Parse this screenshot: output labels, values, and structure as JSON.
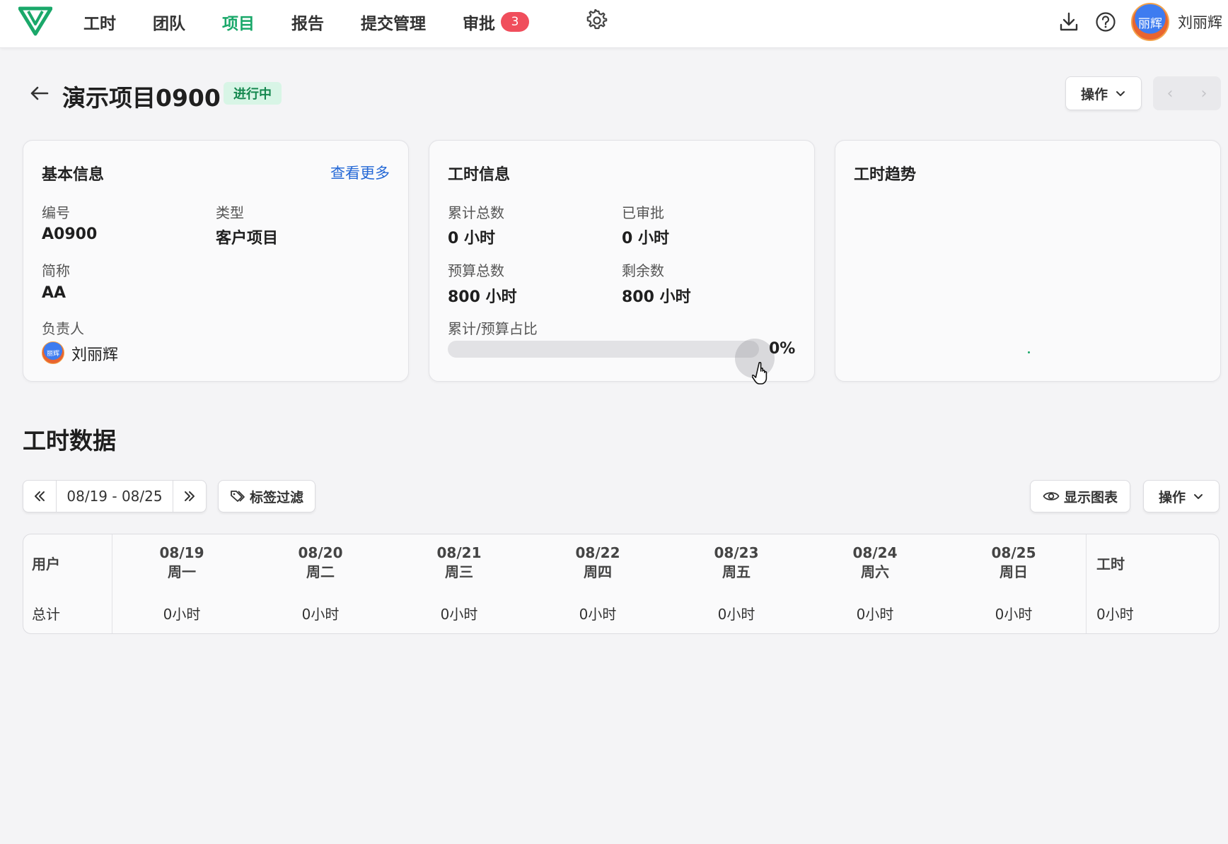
{
  "nav": {
    "items": [
      {
        "label": "工时",
        "active": false
      },
      {
        "label": "团队",
        "active": false
      },
      {
        "label": "项目",
        "active": true
      },
      {
        "label": "报告",
        "active": false
      },
      {
        "label": "提交管理",
        "active": false
      },
      {
        "label": "审批",
        "active": false,
        "badge": "3"
      }
    ],
    "settings_icon": "gear-icon",
    "download_icon": "download-icon",
    "help_icon": "help-circle-icon",
    "avatar_text": "丽辉",
    "user_name": "刘丽辉",
    "accent_color": "#1aa86a",
    "badge_color": "#f04e5c"
  },
  "page": {
    "back_icon": "arrow-left-icon",
    "title": "演示项目0900",
    "status": "进行中",
    "ops_label": "操作"
  },
  "basic_info": {
    "title": "基本信息",
    "more_link": "查看更多",
    "code_label": "编号",
    "code_value": "A0900",
    "type_label": "类型",
    "type_value": "客户项目",
    "short_label": "简称",
    "short_value": "AA",
    "owner_label": "负责人",
    "owner_avatar": "丽辉",
    "owner_name": "刘丽辉"
  },
  "hours_info": {
    "title": "工时信息",
    "total_label": "累计总数",
    "total_value": "0 小时",
    "approved_label": "已审批",
    "approved_value": "0 小时",
    "budget_label": "预算总数",
    "budget_value": "800 小时",
    "remaining_label": "剩余数",
    "remaining_value": "800 小时",
    "ratio_label": "累计/预算占比",
    "ratio_value": 0,
    "ratio_text": "0%"
  },
  "trend": {
    "title": "工时趋势"
  },
  "hours_data": {
    "title": "工时数据",
    "range": "08/19 - 08/25",
    "prev_icon": "double-chevron-left-icon",
    "next_icon": "double-chevron-right-icon",
    "tag_filter": "标签过滤",
    "show_chart": "显示图表",
    "ops_label": "操作",
    "table": {
      "user_header": "用户",
      "total_header": "工时",
      "days": [
        {
          "date": "08/19",
          "weekday": "周一",
          "value": "0小时"
        },
        {
          "date": "08/20",
          "weekday": "周二",
          "value": "0小时"
        },
        {
          "date": "08/21",
          "weekday": "周三",
          "value": "0小时"
        },
        {
          "date": "08/22",
          "weekday": "周四",
          "value": "0小时"
        },
        {
          "date": "08/23",
          "weekday": "周五",
          "value": "0小时"
        },
        {
          "date": "08/24",
          "weekday": "周六",
          "value": "0小时"
        },
        {
          "date": "08/25",
          "weekday": "周日",
          "value": "0小时"
        }
      ],
      "total_row_label": "总计",
      "total_row_value": "0小时"
    }
  }
}
